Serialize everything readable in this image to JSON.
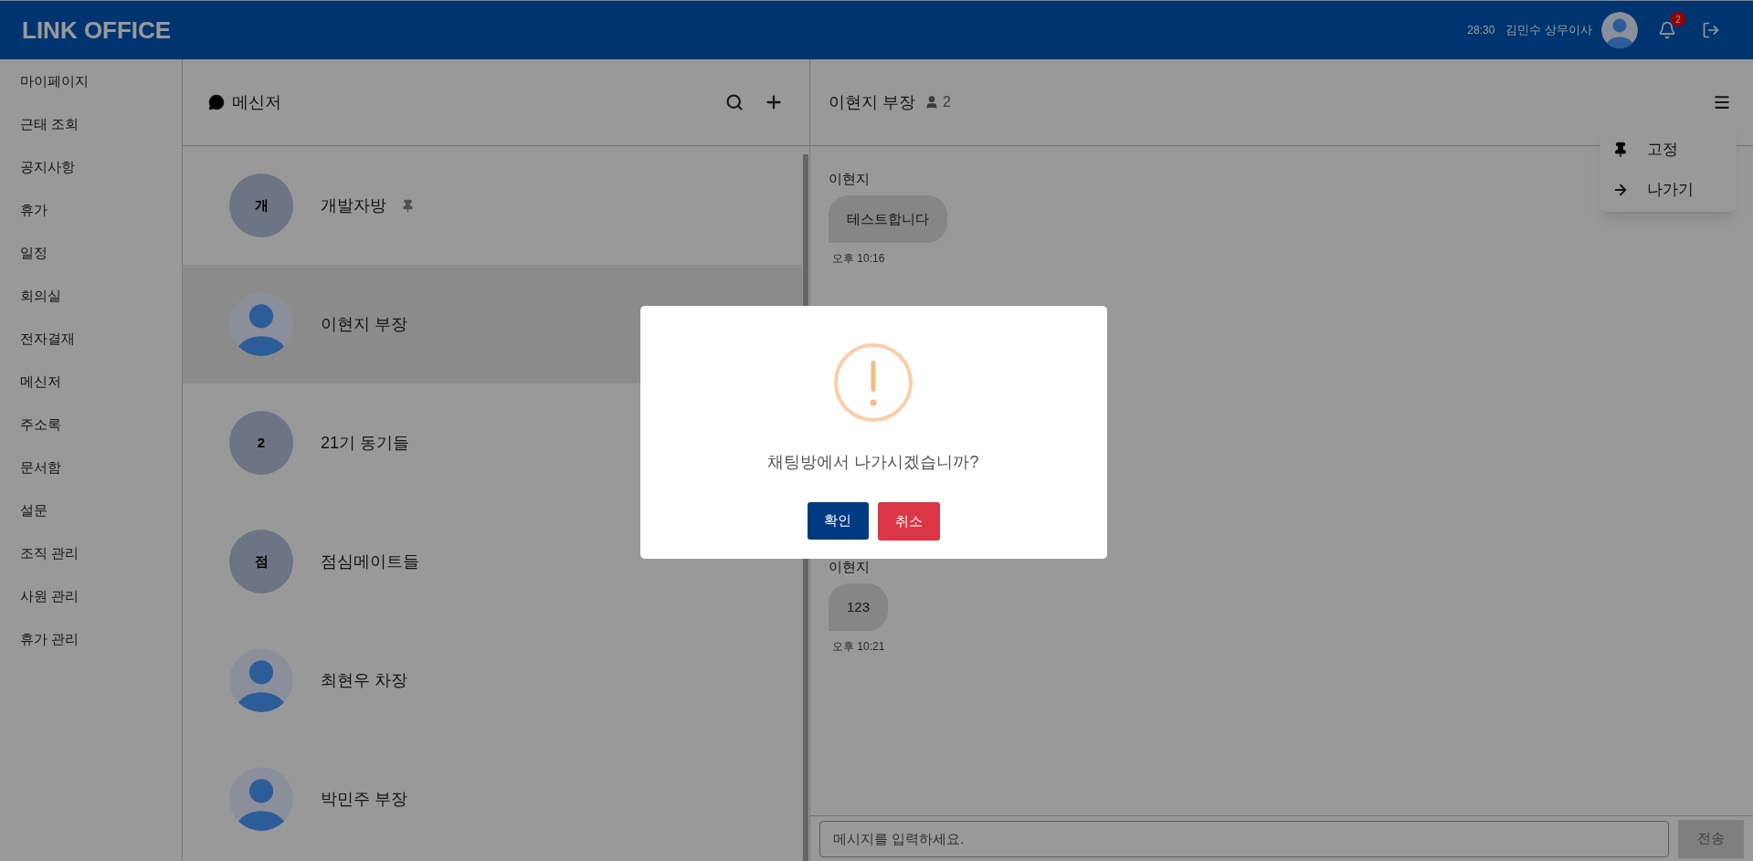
{
  "header": {
    "title": "LINK OFFICE",
    "time": "28:30",
    "user_name": "김민수 상무이사",
    "notification_count": "2"
  },
  "sidebar": {
    "items": [
      {
        "label": "마이페이지"
      },
      {
        "label": "근태 조회"
      },
      {
        "label": "공지사항"
      },
      {
        "label": "휴가"
      },
      {
        "label": "일정"
      },
      {
        "label": "회의실"
      },
      {
        "label": "전자결재"
      },
      {
        "label": "메신저"
      },
      {
        "label": "주소록"
      },
      {
        "label": "문서함"
      },
      {
        "label": "설문"
      },
      {
        "label": "조직 관리"
      },
      {
        "label": "사원 관리"
      },
      {
        "label": "휴가 관리"
      }
    ]
  },
  "messenger": {
    "title": "메신저",
    "rooms": [
      {
        "kind": "group",
        "avatar_text": "개",
        "name": "개발자방",
        "pinned": true,
        "selected": false
      },
      {
        "kind": "person",
        "name": "이현지 부장",
        "pinned": false,
        "selected": true
      },
      {
        "kind": "group",
        "avatar_text": "2",
        "name": "21기 동기들",
        "pinned": false,
        "selected": false
      },
      {
        "kind": "group",
        "avatar_text": "점",
        "name": "점심메이트들",
        "pinned": false,
        "selected": false
      },
      {
        "kind": "person",
        "name": "최현우 차장",
        "pinned": false,
        "selected": false
      },
      {
        "kind": "person",
        "name": "박민주 부장",
        "pinned": false,
        "selected": false
      }
    ]
  },
  "chat": {
    "title": "이현지 부장",
    "member_count": "2",
    "menu": [
      {
        "kind": "pin",
        "label": "고정"
      },
      {
        "kind": "leave",
        "label": "나가기"
      }
    ],
    "messages": [
      {
        "sender": "이현지",
        "text": "테스트합니다",
        "time": "오후 10:16"
      },
      {
        "sender": "이현지",
        "text": "123",
        "time": "오후 10:21"
      }
    ],
    "input": {
      "placeholder": "메시지를 입력하세요."
    },
    "send_button": "전송"
  },
  "dialog": {
    "message": "채팅방에서 나가시겠습니까?",
    "confirm": "확인",
    "cancel": "취소"
  }
}
